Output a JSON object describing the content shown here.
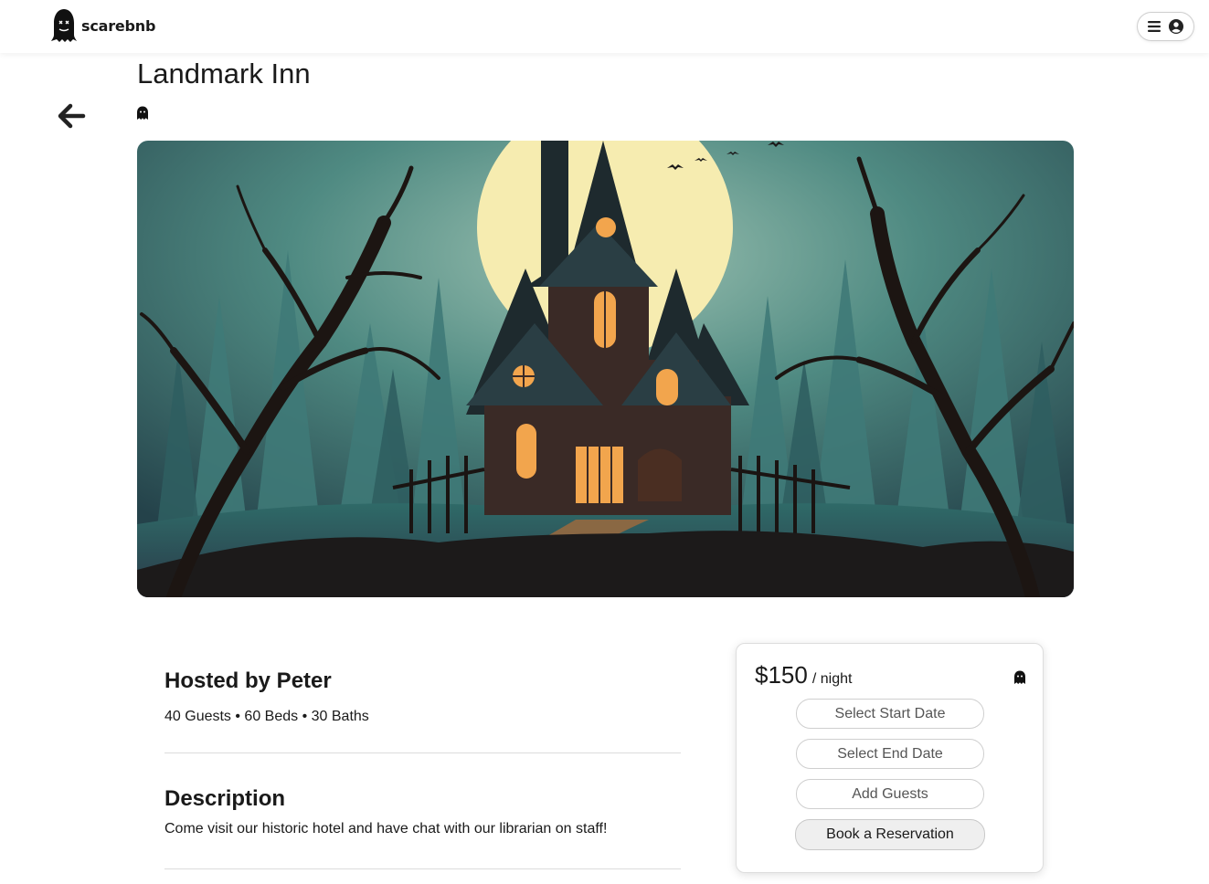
{
  "header": {
    "brand": "scarebnb",
    "logo_icon": "ghost-icon",
    "menu_icon": "hamburger-icon",
    "profile_icon": "user-circle-icon"
  },
  "listing": {
    "title": "Landmark Inn",
    "back_icon": "arrow-left-icon",
    "rating_icon": "ghost-icon",
    "image_subject": "haunted-house-illustration"
  },
  "host": {
    "hosted_by": "Hosted by Peter",
    "stats": "40 Guests • 60 Beds • 30 Baths"
  },
  "description": {
    "heading": "Description",
    "text": "Come visit our historic hotel and have chat with our librarian on staff!"
  },
  "booking": {
    "price": "$150",
    "per_night": "/ night",
    "start_date_label": "Select Start Date",
    "end_date_label": "Select End Date",
    "guests_label": "Add Guests",
    "reserve_label": "Book a Reservation"
  },
  "colors": {
    "text": "#1a1a1a",
    "border": "#cfcfcf",
    "moon": "#f3e6a6",
    "window_glow": "#f0a04a",
    "sky": "#2e5c5c"
  }
}
